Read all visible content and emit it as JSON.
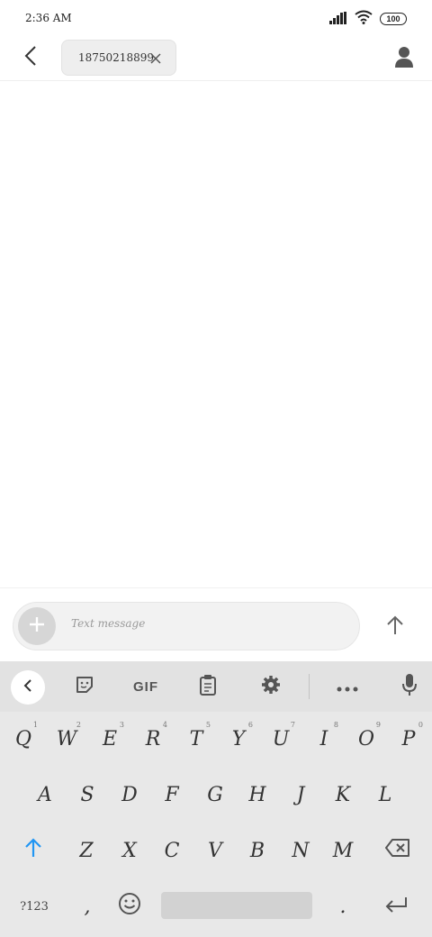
{
  "status": {
    "time": "2:36 AM",
    "battery": "100"
  },
  "header": {
    "recipient": "18750218899"
  },
  "compose": {
    "placeholder": "Text message"
  },
  "keyboard": {
    "toolbar": {
      "gif_label": "GIF"
    },
    "row1": [
      {
        "key": "Q",
        "hint": "1"
      },
      {
        "key": "W",
        "hint": "2"
      },
      {
        "key": "E",
        "hint": "3"
      },
      {
        "key": "R",
        "hint": "4"
      },
      {
        "key": "T",
        "hint": "5"
      },
      {
        "key": "Y",
        "hint": "6"
      },
      {
        "key": "U",
        "hint": "7"
      },
      {
        "key": "I",
        "hint": "8"
      },
      {
        "key": "O",
        "hint": "9"
      },
      {
        "key": "P",
        "hint": "0"
      }
    ],
    "row2": [
      "A",
      "S",
      "D",
      "F",
      "G",
      "H",
      "J",
      "K",
      "L"
    ],
    "row3": [
      "Z",
      "X",
      "C",
      "V",
      "B",
      "N",
      "M"
    ],
    "symbols_label": "?123",
    "comma": ",",
    "period": "."
  }
}
